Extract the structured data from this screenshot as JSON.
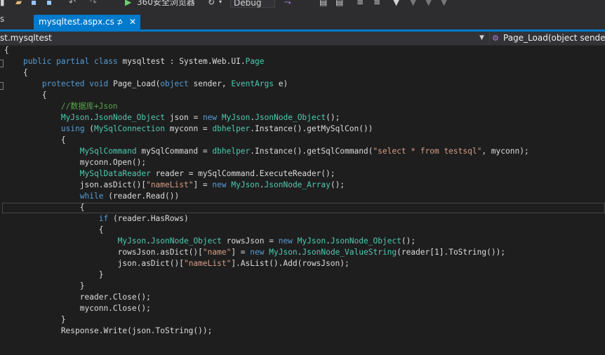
{
  "toolbar": {
    "browser_label": "360安全浏览器",
    "config_select": "Debug"
  },
  "tabs": {
    "left_partial": "s",
    "active": {
      "label": "mysqltest.aspx.cs",
      "pin": "⊅",
      "close": "✕"
    }
  },
  "navbar": {
    "class_selector": "st.mysqltest",
    "member_selector": "Page_Load(object sender"
  },
  "colors": {
    "keyword": "#569cd6",
    "type": "#4ec9b0",
    "string": "#d69d85",
    "comment": "#57a64a",
    "accent": "#007acc"
  },
  "code": {
    "lines": [
      [
        {
          "t": "{"
        }
      ],
      [
        {
          "t": "    "
        },
        {
          "t": "public",
          "c": "kw"
        },
        {
          "t": " "
        },
        {
          "t": "partial",
          "c": "kw"
        },
        {
          "t": " "
        },
        {
          "t": "class",
          "c": "kw"
        },
        {
          "t": " mysqltest : System.Web.UI."
        },
        {
          "t": "Page",
          "c": "ty"
        }
      ],
      [
        {
          "t": "    {"
        }
      ],
      [
        {
          "t": "        "
        },
        {
          "t": "protected",
          "c": "kw"
        },
        {
          "t": " "
        },
        {
          "t": "void",
          "c": "kw"
        },
        {
          "t": " Page_Load("
        },
        {
          "t": "object",
          "c": "kw"
        },
        {
          "t": " sender, "
        },
        {
          "t": "EventArgs",
          "c": "ty"
        },
        {
          "t": " e)"
        }
      ],
      [
        {
          "t": "        {"
        }
      ],
      [
        {
          "t": "            "
        },
        {
          "t": "//数据库+Json",
          "c": "cm"
        }
      ],
      [
        {
          "t": "            "
        },
        {
          "t": "MyJson",
          "c": "ty"
        },
        {
          "t": "."
        },
        {
          "t": "JsonNode_Object",
          "c": "ty"
        },
        {
          "t": " json = "
        },
        {
          "t": "new",
          "c": "kw"
        },
        {
          "t": " "
        },
        {
          "t": "MyJson",
          "c": "ty"
        },
        {
          "t": "."
        },
        {
          "t": "JsonNode_Object",
          "c": "ty"
        },
        {
          "t": "();"
        }
      ],
      [
        {
          "t": "            "
        },
        {
          "t": "using",
          "c": "kw"
        },
        {
          "t": " ("
        },
        {
          "t": "MySqlConnection",
          "c": "ty"
        },
        {
          "t": " myconn = "
        },
        {
          "t": "dbhelper",
          "c": "ty"
        },
        {
          "t": ".Instance().getMySqlCon())"
        }
      ],
      [
        {
          "t": "            {"
        }
      ],
      [
        {
          "t": "                "
        },
        {
          "t": "MySqlCommand",
          "c": "ty"
        },
        {
          "t": " mySqlCommand = "
        },
        {
          "t": "dbhelper",
          "c": "ty"
        },
        {
          "t": ".Instance().getSqlCommand("
        },
        {
          "t": "\"select * from testsql\"",
          "c": "st"
        },
        {
          "t": ", myconn);"
        }
      ],
      [
        {
          "t": "                myconn.Open();"
        }
      ],
      [
        {
          "t": "                "
        },
        {
          "t": "MySqlDataReader",
          "c": "ty"
        },
        {
          "t": " reader = mySqlCommand.ExecuteReader();"
        }
      ],
      [
        {
          "t": "                json.asDict()["
        },
        {
          "t": "\"nameList\"",
          "c": "st"
        },
        {
          "t": "] = "
        },
        {
          "t": "new",
          "c": "kw"
        },
        {
          "t": " "
        },
        {
          "t": "MyJson",
          "c": "ty"
        },
        {
          "t": "."
        },
        {
          "t": "JsonNode_Array",
          "c": "ty"
        },
        {
          "t": "();"
        }
      ],
      [
        {
          "t": "                "
        },
        {
          "t": "while",
          "c": "kw"
        },
        {
          "t": " (reader.Read())"
        }
      ],
      [
        {
          "t": "                {"
        }
      ],
      [
        {
          "t": "                    "
        },
        {
          "t": "if",
          "c": "kw"
        },
        {
          "t": " (reader.HasRows)"
        }
      ],
      [
        {
          "t": "                    {"
        }
      ],
      [
        {
          "t": "                        "
        },
        {
          "t": "MyJson",
          "c": "ty"
        },
        {
          "t": "."
        },
        {
          "t": "JsonNode_Object",
          "c": "ty"
        },
        {
          "t": " rowsJson = "
        },
        {
          "t": "new",
          "c": "kw"
        },
        {
          "t": " "
        },
        {
          "t": "MyJson",
          "c": "ty"
        },
        {
          "t": "."
        },
        {
          "t": "JsonNode_Object",
          "c": "ty"
        },
        {
          "t": "();"
        }
      ],
      [
        {
          "t": "                        rowsJson.asDict()["
        },
        {
          "t": "\"name\"",
          "c": "st"
        },
        {
          "t": "] = "
        },
        {
          "t": "new",
          "c": "kw"
        },
        {
          "t": " "
        },
        {
          "t": "MyJson",
          "c": "ty"
        },
        {
          "t": "."
        },
        {
          "t": "JsonNode_ValueString",
          "c": "ty"
        },
        {
          "t": "(reader[1].ToString());"
        }
      ],
      [
        {
          "t": "                        json.asDict()["
        },
        {
          "t": "\"nameList\"",
          "c": "st"
        },
        {
          "t": "].AsList().Add(rowsJson);"
        }
      ],
      [
        {
          "t": "                    }"
        }
      ],
      [
        {
          "t": "                }"
        }
      ],
      [
        {
          "t": "                reader.Close();"
        }
      ],
      [
        {
          "t": "                myconn.Close();"
        }
      ],
      [
        {
          "t": "            }"
        }
      ],
      [
        {
          "t": "            Response.Write(json.ToString());"
        }
      ]
    ]
  }
}
